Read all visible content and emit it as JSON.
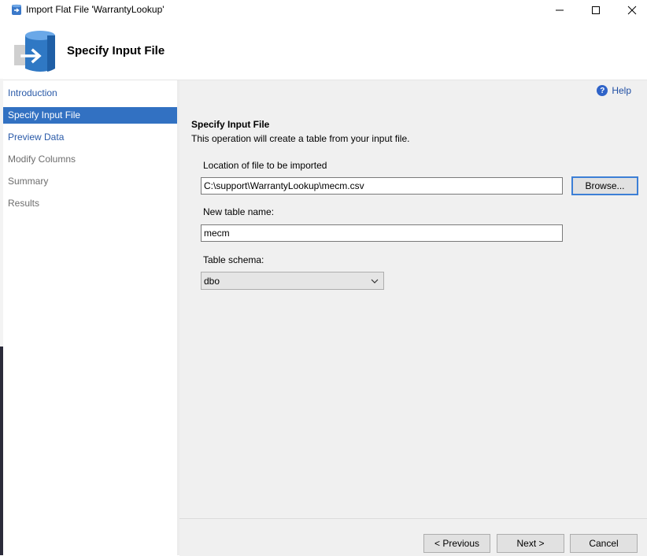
{
  "window": {
    "title": "Import Flat File 'WarrantyLookup'"
  },
  "header": {
    "title": "Specify Input File"
  },
  "nav": {
    "items": [
      {
        "label": "Introduction",
        "state": "done"
      },
      {
        "label": "Specify Input File",
        "state": "active"
      },
      {
        "label": "Preview Data",
        "state": "done"
      },
      {
        "label": "Modify Columns",
        "state": "disabled"
      },
      {
        "label": "Summary",
        "state": "disabled"
      },
      {
        "label": "Results",
        "state": "disabled"
      }
    ]
  },
  "main": {
    "help_label": "Help",
    "section_title": "Specify Input File",
    "section_desc": "This operation will create a table from your input file.",
    "file_location_label": "Location of file to be imported",
    "file_location_value": "C:\\support\\WarrantyLookup\\mecm.csv",
    "browse_label": "Browse...",
    "table_name_label": "New table name:",
    "table_name_value": "mecm",
    "schema_label": "Table schema:",
    "schema_value": "dbo"
  },
  "footer": {
    "previous_label": "< Previous",
    "next_label": "Next >",
    "cancel_label": "Cancel"
  },
  "colors": {
    "accent": "#3271c2",
    "link": "#2a5aa8",
    "panel": "#f0f0f0"
  }
}
